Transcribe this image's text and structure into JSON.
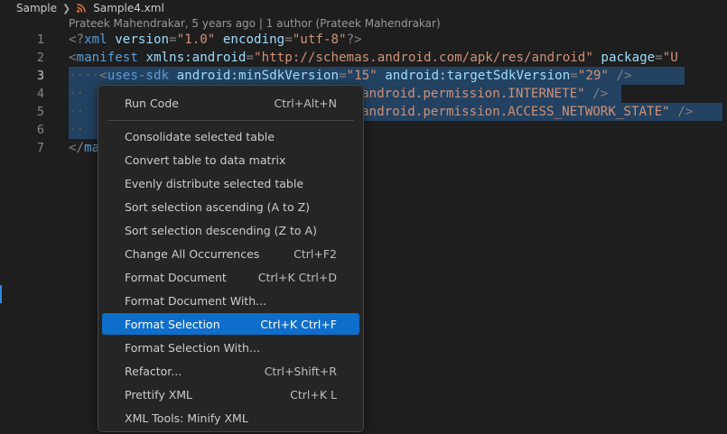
{
  "breadcrumb": {
    "folder": "Sample",
    "file": "Sample4.xml"
  },
  "codelens": "Prateek Mahendrakar, 5 years ago | 1 author (Prateek Mahendrakar)",
  "editor": {
    "line_numbers": [
      "1",
      "2",
      "3",
      "4",
      "5",
      "6",
      "7"
    ],
    "line1": {
      "open": "<?",
      "tag": "xml",
      "a1": "version",
      "eq1": "=",
      "v1": "\"1.0\"",
      "a2": "encoding",
      "eq2": "=",
      "v2": "\"utf-8\"",
      "close": "?>"
    },
    "line2": {
      "open": "<",
      "tag": "manifest",
      "a1": "xmlns:android",
      "eq1": "=",
      "v1": "\"http://schemas.android.com/apk/res/android\"",
      "a2": "package",
      "eq2": "=",
      "v2": "\"U"
    },
    "line3": {
      "ws": "····",
      "open": "<",
      "tag": "uses-sdk",
      "a1": "android:minSdkVersion",
      "eq1": "=",
      "v1": "\"15\"",
      "a2": "android:targetSdkVersion",
      "eq2": "=",
      "v2": "\"29\"",
      "close": " />"
    },
    "line4": {
      "ws": "··",
      "value": "android.permission.INTERNETE\" ",
      "close": "/>"
    },
    "line5": {
      "ws": "··",
      "value": "android.permission.ACCESS_NETWORK_STATE\" ",
      "close": "/>"
    },
    "line6": {
      "ws": "··"
    },
    "line7": {
      "open": "</",
      "tag": "ma"
    }
  },
  "menu": {
    "items": [
      {
        "label": "Run Code",
        "shortcut": "Ctrl+Alt+N"
      },
      {
        "label": "Consolidate selected table",
        "shortcut": ""
      },
      {
        "label": "Convert table to data matrix",
        "shortcut": ""
      },
      {
        "label": "Evenly distribute selected table",
        "shortcut": ""
      },
      {
        "label": "Sort selection ascending (A to Z)",
        "shortcut": ""
      },
      {
        "label": "Sort selection descending (Z to A)",
        "shortcut": ""
      },
      {
        "label": "Change All Occurrences",
        "shortcut": "Ctrl+F2"
      },
      {
        "label": "Format Document",
        "shortcut": "Ctrl+K Ctrl+D"
      },
      {
        "label": "Format Document With...",
        "shortcut": ""
      },
      {
        "label": "Format Selection",
        "shortcut": "Ctrl+K Ctrl+F"
      },
      {
        "label": "Format Selection With...",
        "shortcut": ""
      },
      {
        "label": "Refactor...",
        "shortcut": "Ctrl+Shift+R"
      },
      {
        "label": "Prettify XML",
        "shortcut": "Ctrl+K L"
      },
      {
        "label": "XML Tools: Minify XML",
        "shortcut": ""
      }
    ],
    "highlighted_item": "Format Selection"
  },
  "colors": {
    "background": "#1e1e1e",
    "selection": "#264f78",
    "menu_highlight": "#0e6ecb",
    "tag": "#569cd6",
    "attribute": "#9cdcfe",
    "string": "#ce9178"
  },
  "icons": {
    "breadcrumb_chevron": "chevron-right-icon",
    "file_icon": "rss-icon"
  }
}
